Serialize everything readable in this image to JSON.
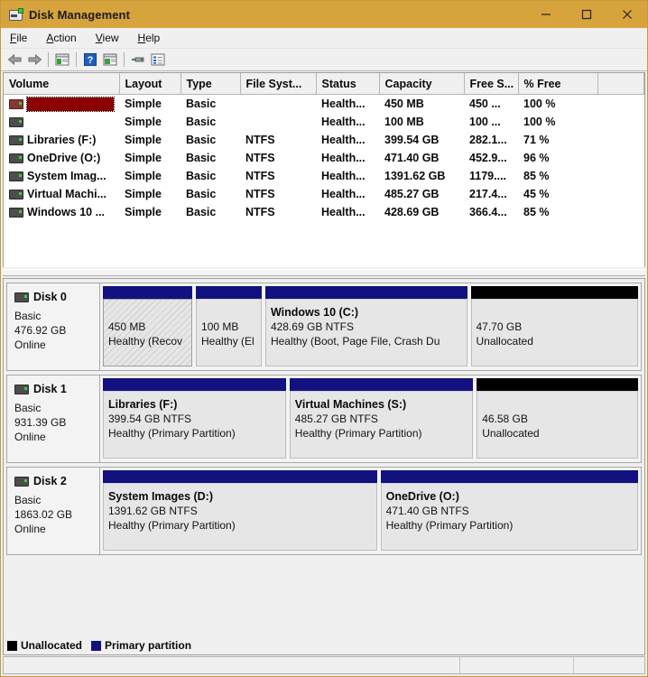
{
  "window": {
    "title": "Disk Management",
    "icon": "disk-drive-icon",
    "titlebar_color": "#d7a33c",
    "controls": {
      "minimize": "–",
      "maximize": "□",
      "close": "✕"
    }
  },
  "menubar": {
    "items": [
      {
        "label": "File",
        "accel": "F"
      },
      {
        "label": "Action",
        "accel": "A"
      },
      {
        "label": "View",
        "accel": "V"
      },
      {
        "label": "Help",
        "accel": "H"
      }
    ]
  },
  "toolbar": {
    "items": [
      {
        "name": "back-arrow-icon",
        "title": "Back"
      },
      {
        "name": "forward-arrow-icon",
        "title": "Forward"
      },
      {
        "name": "separator-1",
        "title": ""
      },
      {
        "name": "show-console-tree-icon",
        "title": "Show/Hide Console Tree"
      },
      {
        "name": "separator-2",
        "title": ""
      },
      {
        "name": "help-icon",
        "title": "Help"
      },
      {
        "name": "show-action-pane-icon",
        "title": "Show/Hide Action Pane"
      },
      {
        "name": "separator-3",
        "title": ""
      },
      {
        "name": "rescan-disks-icon",
        "title": "Rescan Disks"
      },
      {
        "name": "properties-icon",
        "title": "Properties"
      }
    ]
  },
  "volume_list": {
    "columns": [
      "Volume",
      "Layout",
      "Type",
      "File Syst...",
      "Status",
      "Capacity",
      "Free S...",
      "% Free",
      ""
    ],
    "rows": [
      {
        "volume": "",
        "selected": true,
        "icon": "drive-icon-selected",
        "layout": "Simple",
        "type": "Basic",
        "file_system": "",
        "status": "Health...",
        "capacity": "450 MB",
        "free_space": "450 ...",
        "percent_free": "100 %"
      },
      {
        "volume": "",
        "selected": false,
        "icon": "drive-icon",
        "layout": "Simple",
        "type": "Basic",
        "file_system": "",
        "status": "Health...",
        "capacity": "100 MB",
        "free_space": "100 ...",
        "percent_free": "100 %"
      },
      {
        "volume": "Libraries (F:)",
        "selected": false,
        "icon": "drive-icon",
        "layout": "Simple",
        "type": "Basic",
        "file_system": "NTFS",
        "status": "Health...",
        "capacity": "399.54 GB",
        "free_space": "282.1...",
        "percent_free": "71 %"
      },
      {
        "volume": "OneDrive (O:)",
        "selected": false,
        "icon": "drive-icon",
        "layout": "Simple",
        "type": "Basic",
        "file_system": "NTFS",
        "status": "Health...",
        "capacity": "471.40 GB",
        "free_space": "452.9...",
        "percent_free": "96 %"
      },
      {
        "volume": "System Imag...",
        "selected": false,
        "icon": "drive-icon",
        "layout": "Simple",
        "type": "Basic",
        "file_system": "NTFS",
        "status": "Health...",
        "capacity": "1391.62 GB",
        "free_space": "1179....",
        "percent_free": "85 %"
      },
      {
        "volume": "Virtual Machi...",
        "selected": false,
        "icon": "drive-icon",
        "layout": "Simple",
        "type": "Basic",
        "file_system": "NTFS",
        "status": "Health...",
        "capacity": "485.27 GB",
        "free_space": "217.4...",
        "percent_free": "45 %"
      },
      {
        "volume": "Windows 10 ...",
        "selected": false,
        "icon": "drive-icon",
        "layout": "Simple",
        "type": "Basic",
        "file_system": "NTFS",
        "status": "Health...",
        "capacity": "428.69 GB",
        "free_space": "366.4...",
        "percent_free": "85 %"
      }
    ]
  },
  "disks": [
    {
      "name": "Disk 0",
      "type": "Basic",
      "size": "476.92 GB",
      "state": "Online",
      "partitions": [
        {
          "title": "",
          "size_fs": "450 MB",
          "status": "Healthy (Recov",
          "kind": "primary",
          "selected": true,
          "width_pct": 16.7
        },
        {
          "title": "",
          "size_fs": "100 MB",
          "status": "Healthy (El",
          "kind": "primary",
          "selected": false,
          "width_pct": 12.3
        },
        {
          "title": "Windows 10  (C:)",
          "size_fs": "428.69 GB NTFS",
          "status": "Healthy (Boot, Page File, Crash Du",
          "kind": "primary",
          "selected": false,
          "width_pct": 37.7
        },
        {
          "title": "",
          "size_fs": "47.70 GB",
          "status": "Unallocated",
          "kind": "unallocated",
          "selected": false,
          "width_pct": 31.6
        }
      ]
    },
    {
      "name": "Disk 1",
      "type": "Basic",
      "size": "931.39 GB",
      "state": "Online",
      "partitions": [
        {
          "title": "Libraries  (F:)",
          "size_fs": "399.54 GB NTFS",
          "status": "Healthy (Primary Partition)",
          "kind": "primary",
          "selected": false,
          "width_pct": 34.2
        },
        {
          "title": "Virtual Machines  (S:)",
          "size_fs": "485.27 GB NTFS",
          "status": "Healthy (Primary Partition)",
          "kind": "primary",
          "selected": false,
          "width_pct": 34.3
        },
        {
          "title": "",
          "size_fs": "46.58 GB",
          "status": "Unallocated",
          "kind": "unallocated",
          "selected": false,
          "width_pct": 29.0
        }
      ]
    },
    {
      "name": "Disk 2",
      "type": "Basic",
      "size": "1863.02 GB",
      "state": "Online",
      "partitions": [
        {
          "title": "System Images  (D:)",
          "size_fs": "1391.62 GB NTFS",
          "status": "Healthy (Primary Partition)",
          "kind": "primary",
          "selected": false,
          "width_pct": 51.2
        },
        {
          "title": "OneDrive  (O:)",
          "size_fs": "471.40 GB NTFS",
          "status": "Healthy (Primary Partition)",
          "kind": "primary",
          "selected": false,
          "width_pct": 47.6
        }
      ]
    }
  ],
  "legend": [
    {
      "label": "Unallocated",
      "color": "#000000",
      "swatch": "unalloc"
    },
    {
      "label": "Primary partition",
      "color": "#11117f",
      "swatch": "primary"
    }
  ],
  "statusbar": {
    "left": "",
    "middle": "",
    "right": ""
  }
}
